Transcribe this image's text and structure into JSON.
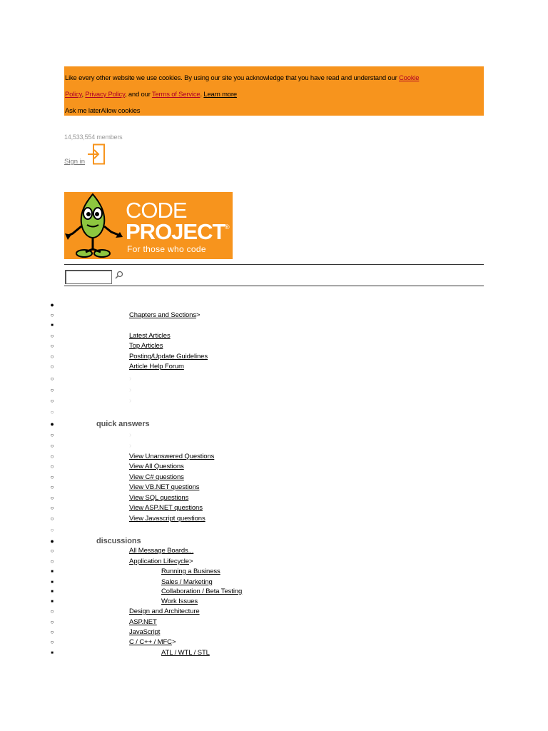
{
  "cookie_banner": {
    "text1": "Like every other website we use cookies. By using our site you acknowledge that you have read and understand our ",
    "cookie_policy_a": "Cookie ",
    "cookie_policy_b": "Policy",
    "sep1": ", ",
    "privacy_policy": "Privacy Policy",
    "sep2": ", and our ",
    "terms": "Terms of Service",
    "sep3": ". ",
    "learn_more": "Learn more",
    "ask_later": "Ask me later",
    "allow": "Allow cookies"
  },
  "header": {
    "members": "14,533,554 members",
    "sign_in": "Sign in"
  },
  "logo": {
    "line1": "CODE",
    "line2": "PROJECT",
    "tagline": "For those who code",
    "registered": "®"
  },
  "colors": {
    "orange": "#f7941d",
    "link_red": "#b00027",
    "mascot_green": "#8dc63f"
  },
  "search": {
    "placeholder": "",
    "icon": "search-icon"
  },
  "nav": {
    "articles_items": {
      "chapters": "Chapters and Sections",
      "arrow": ">",
      "latest": "Latest Articles",
      "top": "Top Articles",
      "guidelines": "Posting/Update Guidelines",
      "help_forum": "Article Help Forum"
    },
    "quick_answers": {
      "label": "quick answers",
      "items": [
        "View Unanswered Questions",
        "View All Questions",
        "View C# questions",
        "View VB.NET questions",
        "View SQL questions",
        "View ASP.NET questions",
        "View Javascript questions"
      ]
    },
    "discussions": {
      "label": "discussions",
      "all_boards": "All Message Boards...",
      "app_lifecycle": "Application Lifecycle",
      "arrow": ">",
      "lifecycle_sub": [
        "Running a Business",
        "Sales / Marketing",
        "Collaboration / Beta Testing",
        "Work Issues"
      ],
      "design": "Design and Architecture",
      "aspnet": "ASP.NET",
      "javascript": "JavaScript",
      "cpp": "C / C++ / MFC",
      "cpp_arrow": ">",
      "cpp_sub": [
        "ATL / WTL / STL"
      ]
    }
  }
}
